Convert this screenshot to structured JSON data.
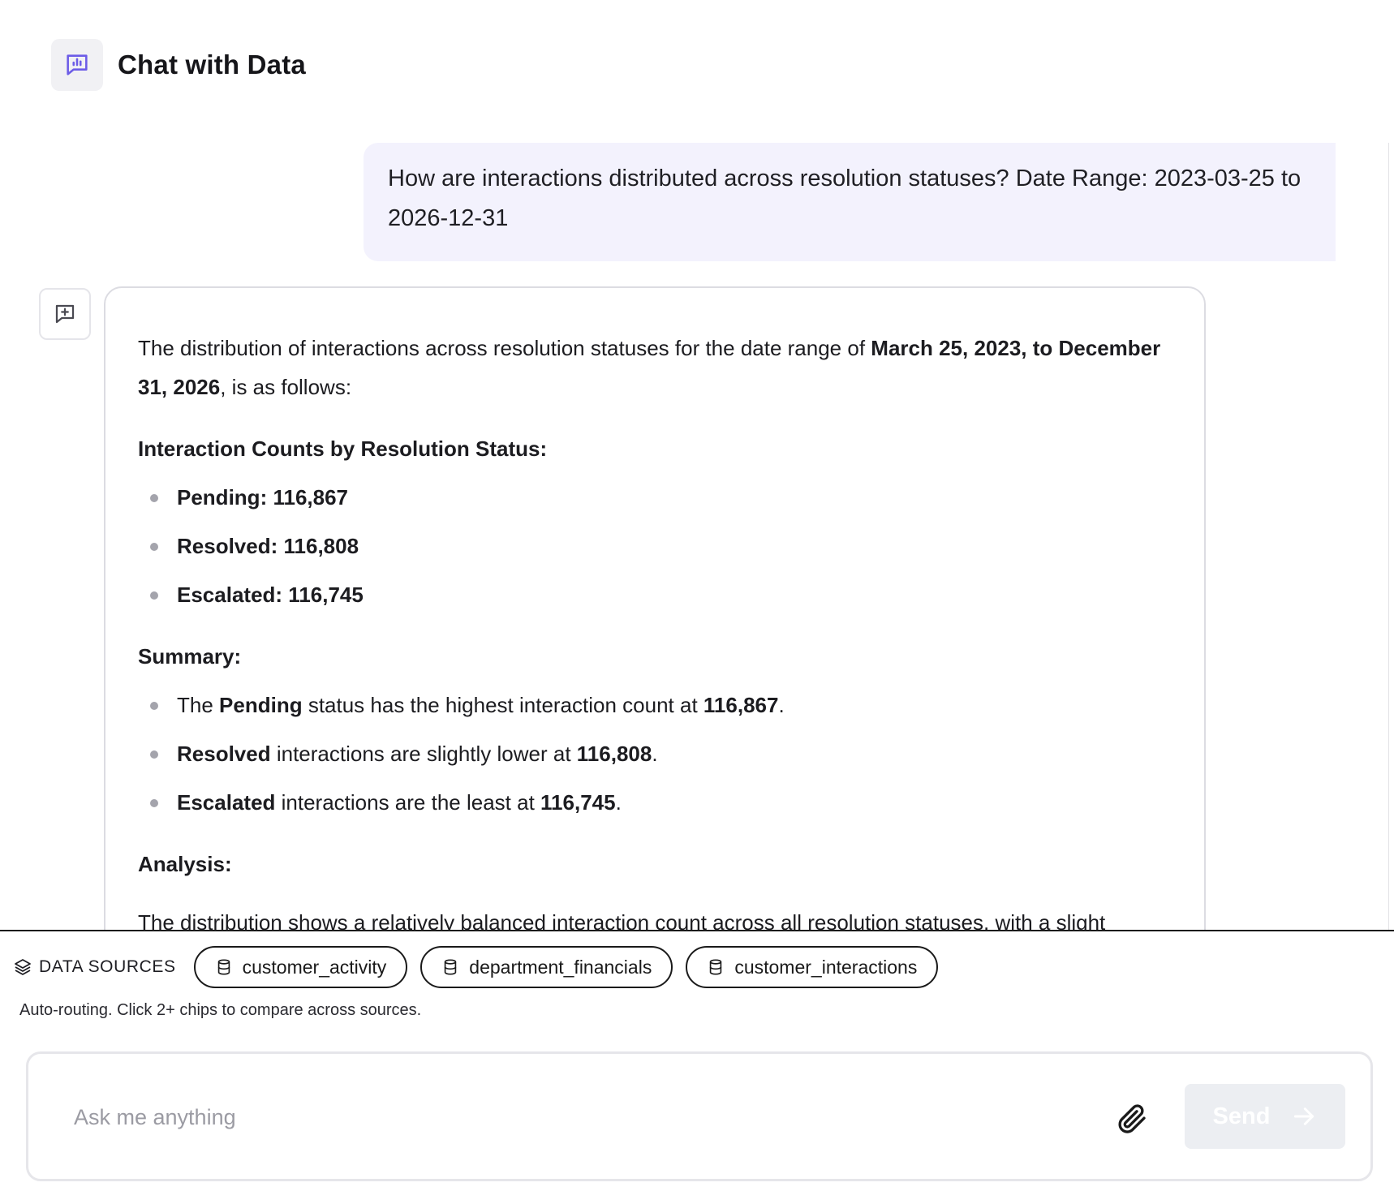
{
  "header": {
    "title": "Chat with Data",
    "logo_icon": "chart-bubble-icon"
  },
  "user_message": {
    "text": "How are interactions distributed across resolution statuses? Date Range: 2023-03-25 to 2026-12-31"
  },
  "answer": {
    "intro_prefix": "The distribution of interactions across resolution statuses for the date range of ",
    "intro_bold": "March 25, 2023, to December 31, 2026",
    "intro_suffix": ", is as follows:",
    "counts_heading": "Interaction Counts by Resolution Status:",
    "counts": [
      {
        "label": "Pending",
        "value": "116,867"
      },
      {
        "label": "Resolved",
        "value": "116,808"
      },
      {
        "label": "Escalated",
        "value": "116,745"
      }
    ],
    "summary_heading": "Summary:",
    "summary": [
      {
        "pre": "The ",
        "b1": "Pending",
        "mid": " status has the highest interaction count at ",
        "b2": "116,867",
        "post": "."
      },
      {
        "pre": "",
        "b1": "Resolved",
        "mid": " interactions are slightly lower at ",
        "b2": "116,808",
        "post": "."
      },
      {
        "pre": "",
        "b1": "Escalated",
        "mid": " interactions are the least at ",
        "b2": "116,745",
        "post": "."
      }
    ],
    "analysis_heading": "Analysis:",
    "analysis_text": "The distribution shows a relatively balanced interaction count across all resolution statuses, with a slight"
  },
  "data_sources": {
    "label": "DATA SOURCES",
    "chips": [
      "customer_activity",
      "department_financials",
      "customer_interactions"
    ],
    "hint": "Auto-routing. Click 2+ chips to compare across sources."
  },
  "composer": {
    "placeholder": "Ask me anything",
    "send_label": "Send"
  },
  "colors": {
    "accent": "#6c5ce7",
    "user_bubble": "#f3f2fd",
    "send_disabled": "#eceef2"
  }
}
